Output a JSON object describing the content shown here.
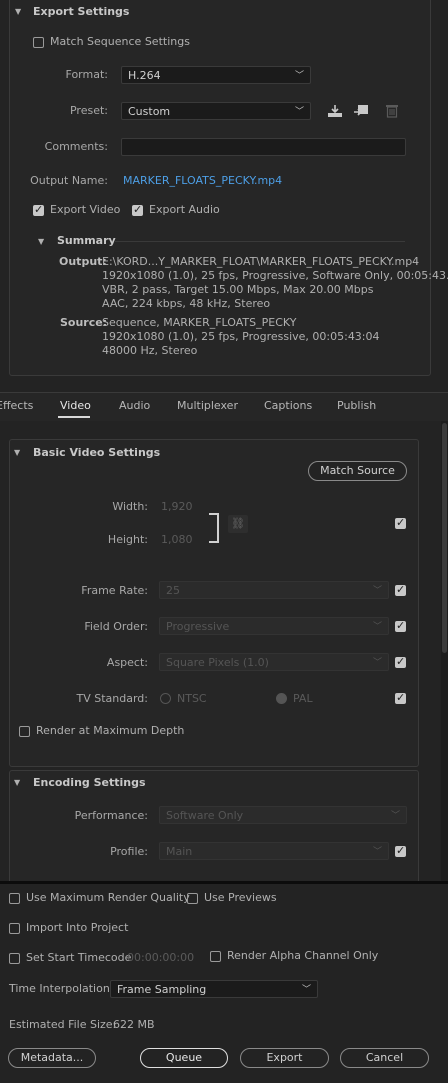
{
  "export_settings": {
    "header": "Export Settings",
    "match_sequence_label": "Match Sequence Settings",
    "format_label": "Format:",
    "format_value": "H.264",
    "preset_label": "Preset:",
    "preset_value": "Custom",
    "comments_label": "Comments:",
    "comments_value": "",
    "output_name_label": "Output Name:",
    "output_name_value": "MARKER_FLOATS_PECKY.mp4",
    "export_video_label": "Export Video",
    "export_audio_label": "Export Audio",
    "summary": {
      "header": "Summary",
      "output_label": "Output:",
      "output_lines": [
        "E:\\KORD...Y_MARKER_FLOAT\\MARKER_FLOATS_PECKY.mp4",
        "1920x1080 (1.0), 25 fps, Progressive, Software Only, 00:05:43...",
        "VBR, 2 pass, Target 15.00 Mbps, Max 20.00 Mbps",
        "AAC, 224 kbps, 48 kHz, Stereo"
      ],
      "source_label": "Source:",
      "source_lines": [
        "Sequence, MARKER_FLOATS_PECKY",
        "1920x1080 (1.0), 25 fps, Progressive, 00:05:43:04",
        "48000 Hz, Stereo"
      ]
    }
  },
  "tabs": [
    "Effects",
    "Video",
    "Audio",
    "Multiplexer",
    "Captions",
    "Publish"
  ],
  "basic_video": {
    "header": "Basic Video Settings",
    "match_source_label": "Match Source",
    "width_label": "Width:",
    "width_value": "1,920",
    "height_label": "Height:",
    "height_value": "1,080",
    "frame_rate_label": "Frame Rate:",
    "frame_rate_value": "25",
    "field_order_label": "Field Order:",
    "field_order_value": "Progressive",
    "aspect_label": "Aspect:",
    "aspect_value": "Square Pixels (1.0)",
    "tv_standard_label": "TV Standard:",
    "ntsc_label": "NTSC",
    "pal_label": "PAL",
    "render_max_depth_label": "Render at Maximum Depth"
  },
  "encoding": {
    "header": "Encoding Settings",
    "performance_label": "Performance:",
    "performance_value": "Software Only",
    "profile_label": "Profile:",
    "profile_value": "Main"
  },
  "bottom": {
    "max_render_quality_label": "Use Maximum Render Quality",
    "use_previews_label": "Use Previews",
    "import_into_project_label": "Import Into Project",
    "set_start_timecode_label": "Set Start Timecode",
    "start_timecode_value": "00:00:00:00",
    "render_alpha_label": "Render Alpha Channel Only",
    "time_interpolation_label": "Time Interpolation:",
    "time_interpolation_value": "Frame Sampling",
    "estimated_size_label": "Estimated File Size:",
    "estimated_size_value": "622 MB",
    "metadata_label": "Metadata...",
    "queue_label": "Queue",
    "export_label": "Export",
    "cancel_label": "Cancel"
  }
}
